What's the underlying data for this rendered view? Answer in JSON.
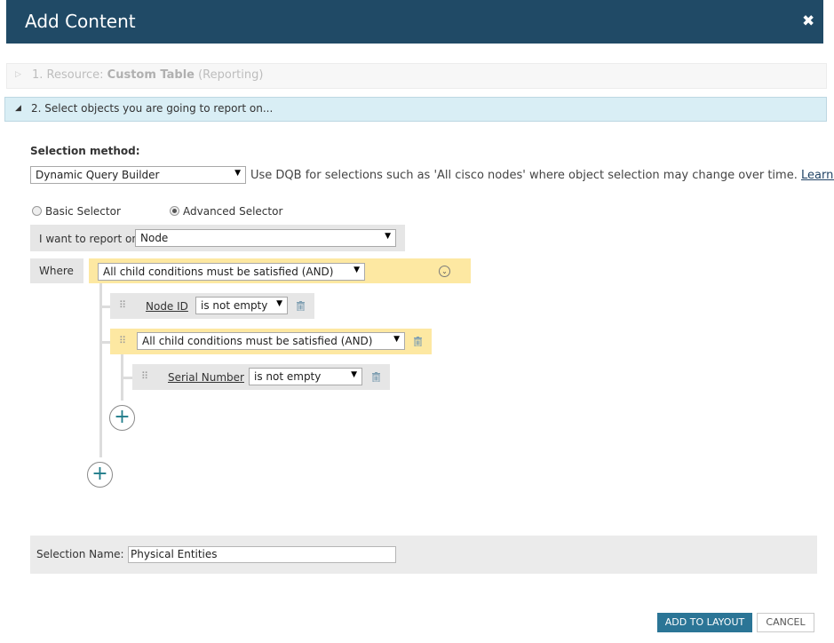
{
  "dialog": {
    "title": "Add Content",
    "close_symbol": "✖"
  },
  "steps": [
    {
      "number_prefix": "1. Resource: ",
      "name": "Custom Table",
      "suffix": " (Reporting)",
      "expanded": false
    },
    {
      "label": "2. Select objects you are going to report on...",
      "expanded": true
    }
  ],
  "selection_method": {
    "label": "Selection method:",
    "value": "Dynamic Query Builder",
    "help_text": "Use DQB for selections such as 'All cisco nodes' where object selection may change over time.",
    "learn_more": "Learn More"
  },
  "selector_modes": [
    {
      "label": "Basic Selector",
      "checked": false
    },
    {
      "label": "Advanced Selector",
      "checked": true
    }
  ],
  "report_on": {
    "label": "I want to report on",
    "value": "Node"
  },
  "query": {
    "where_label": "Where",
    "root_condition": "All child conditions must be satisfied (AND)",
    "rules": [
      {
        "field": "Node ID",
        "operator": "is not empty"
      },
      {
        "group_condition": "All child conditions must be satisfied (AND)",
        "rules": [
          {
            "field": "Serial Number",
            "operator": "is not empty"
          }
        ]
      }
    ],
    "add_symbol": "+"
  },
  "selection_name": {
    "label": "Selection Name:",
    "value": "Physical Entities"
  },
  "buttons": {
    "add_to_layout": "ADD TO LAYOUT",
    "cancel": "CANCEL"
  },
  "colors": {
    "title_bar": "#204a66",
    "step_active": "#d9eef5",
    "condition_group": "#fde8a2",
    "primary_button": "#2b7596",
    "add_icon": "#1f7c8a"
  },
  "icons": {
    "expand": "chevron-down-circle-icon",
    "drag": "drag-handle-icon",
    "delete": "trash-icon",
    "add": "plus-circle-icon"
  }
}
